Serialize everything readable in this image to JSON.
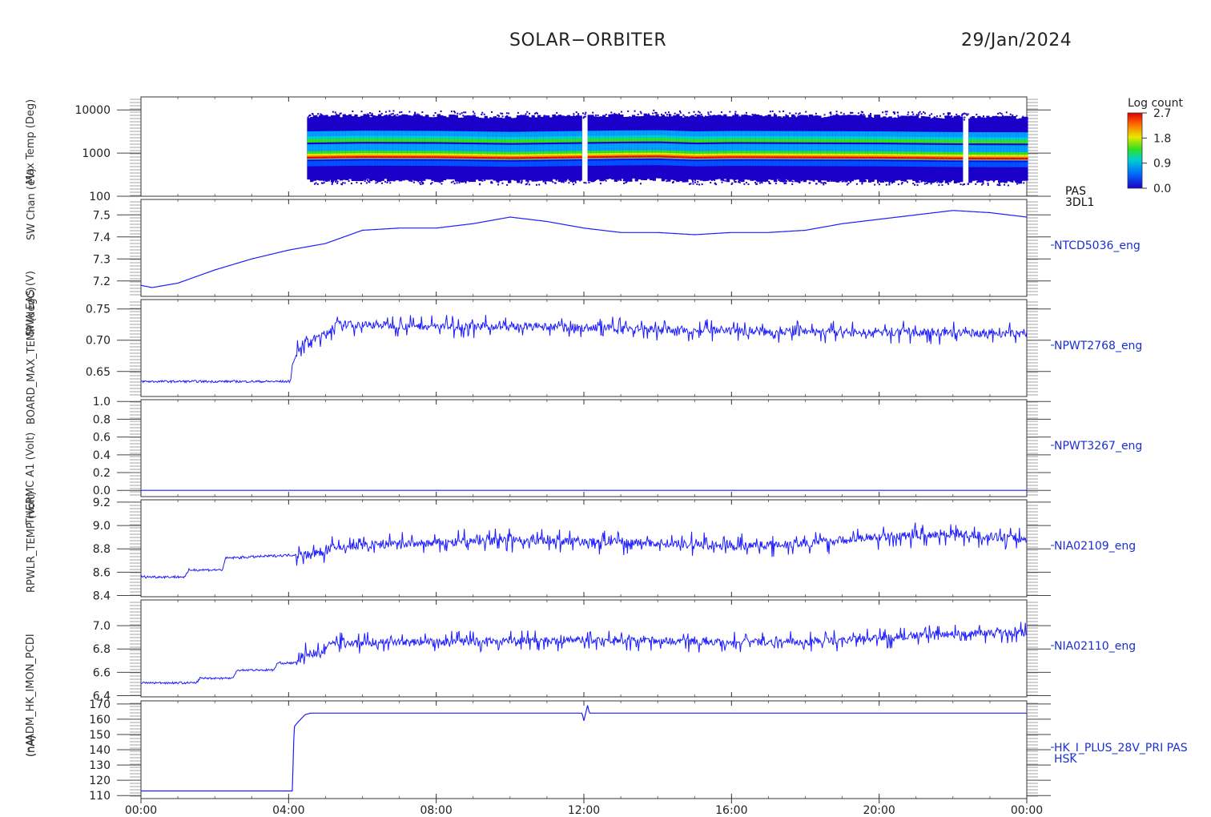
{
  "header": {
    "mission": "SOLAR−ORBITER",
    "date": "29/Jan/2024"
  },
  "colorbar": {
    "title": "Log count",
    "ticks": [
      "2.7",
      "1.8",
      "0.9",
      "0.0"
    ]
  },
  "x_axis": {
    "ticks": [
      "00:00",
      "04:00",
      "08:00",
      "12:00",
      "16:00",
      "20:00",
      "00:00"
    ]
  },
  "rotated_labels": {
    "col1": "(nA)",
    "col2": "(nA)",
    "col3": "ADM_HK_IMON_PCDI",
    "col4": "RPWLR_TEMP (Volt)",
    "col5": "THERMC A1 (Volt)",
    "col6": "BOARD_MAX_TEMP (degC)",
    "col7": "SWA EAS (V)",
    "col8": "SW Chan (eV)",
    "col9": "Max Temp (Deg)"
  },
  "chart_data": [
    {
      "type": "heatmap",
      "name_label": [
        "PAS",
        "3DL1"
      ],
      "yscale": "log",
      "ylim": [
        100,
        20000
      ],
      "yticks": [
        "10000",
        "1000",
        "100"
      ],
      "colorbar_range": [
        0.0,
        2.7
      ],
      "data_start_hour": 4.5,
      "gap_hours": [
        12.0,
        22.3
      ],
      "band_center_ev": [
        [
          4.5,
          800
        ],
        [
          6,
          830
        ],
        [
          8,
          820
        ],
        [
          10,
          780
        ],
        [
          11,
          800
        ],
        [
          12,
          820
        ],
        [
          13,
          840
        ],
        [
          14,
          850
        ],
        [
          15,
          800
        ],
        [
          16,
          820
        ],
        [
          18,
          810
        ],
        [
          20,
          800
        ],
        [
          22,
          770
        ],
        [
          24,
          760
        ]
      ]
    },
    {
      "type": "line",
      "name": "NTCD5036_eng",
      "ylim": [
        7.13,
        7.57
      ],
      "yticks": [
        "7.5",
        "7.4",
        "7.3",
        "7.2"
      ],
      "x": [
        0,
        0.3,
        1,
        2,
        3,
        4,
        5,
        6,
        7,
        8,
        9,
        10,
        11,
        12,
        13,
        14,
        15,
        16,
        17,
        18,
        19,
        20,
        21,
        22,
        23,
        24
      ],
      "y": [
        7.18,
        7.17,
        7.19,
        7.25,
        7.3,
        7.34,
        7.37,
        7.43,
        7.44,
        7.44,
        7.46,
        7.49,
        7.47,
        7.44,
        7.42,
        7.42,
        7.41,
        7.42,
        7.42,
        7.43,
        7.46,
        7.48,
        7.5,
        7.52,
        7.51,
        7.49
      ]
    },
    {
      "type": "line",
      "name": "NPWT2768_eng",
      "ylim": [
        0.61,
        0.765
      ],
      "yticks": [
        "0.75",
        "0.70",
        "0.65"
      ],
      "x": [
        0,
        4.05,
        4.1,
        4.3,
        4.6,
        5.0,
        5.3,
        6,
        8,
        10,
        12,
        14,
        16,
        18,
        20,
        22,
        24
      ],
      "y": [
        0.634,
        0.634,
        0.66,
        0.69,
        0.7,
        0.71,
        0.725,
        0.725,
        0.722,
        0.722,
        0.72,
        0.718,
        0.714,
        0.713,
        0.712,
        0.712,
        0.71
      ],
      "noise_amplitude": 0.012
    },
    {
      "type": "line",
      "name": "NPWT3267_eng",
      "ylim": [
        -0.07,
        1.02
      ],
      "yticks": [
        "1.0",
        "0.8",
        "0.6",
        "0.4",
        "0.2",
        "0.0"
      ],
      "x": [
        0,
        24
      ],
      "y": [
        0.0,
        0.0
      ]
    },
    {
      "type": "line",
      "name": "NIA02109_eng",
      "ylim": [
        8.39,
        9.22
      ],
      "yticks": [
        "9.2",
        "9.0",
        "8.8",
        "8.6",
        "8.4"
      ],
      "x": [
        0,
        1.2,
        1.3,
        2.2,
        2.3,
        4.9,
        5.0,
        6,
        8,
        10,
        12,
        14,
        16,
        18,
        20,
        22,
        24
      ],
      "y": [
        8.56,
        8.56,
        8.62,
        8.62,
        8.72,
        8.76,
        8.8,
        8.83,
        8.85,
        8.88,
        8.86,
        8.85,
        8.82,
        8.85,
        8.9,
        8.93,
        8.88
      ],
      "noise_amplitude": 0.07
    },
    {
      "type": "line",
      "name": "NIA02110_eng",
      "ylim": [
        6.39,
        7.22
      ],
      "yticks": [
        "7.0",
        "6.8",
        "6.6",
        "6.4"
      ],
      "x": [
        0,
        1.5,
        1.6,
        2.5,
        2.6,
        3.6,
        3.7,
        4.3,
        4.4,
        5.0,
        5.1,
        8,
        12,
        16,
        18,
        20,
        22,
        24
      ],
      "y": [
        6.51,
        6.51,
        6.55,
        6.55,
        6.62,
        6.62,
        6.68,
        6.68,
        6.76,
        6.76,
        6.85,
        6.86,
        6.88,
        6.86,
        6.86,
        6.89,
        6.93,
        6.94
      ],
      "noise_amplitude": 0.06
    },
    {
      "type": "line",
      "name_label": [
        "HK_I_PLUS_28V_PRI PAS",
        "HSK"
      ],
      "ylim": [
        108,
        172
      ],
      "yticks": [
        "170",
        "160",
        "150",
        "140",
        "130",
        "120",
        "110"
      ],
      "x": [
        0,
        4.1,
        4.15,
        4.25,
        4.45,
        4.6,
        11.95,
        12.0,
        12.1,
        12.15,
        24
      ],
      "y": [
        113,
        113,
        155,
        158,
        163,
        164,
        164,
        159,
        169,
        164,
        164
      ]
    }
  ]
}
